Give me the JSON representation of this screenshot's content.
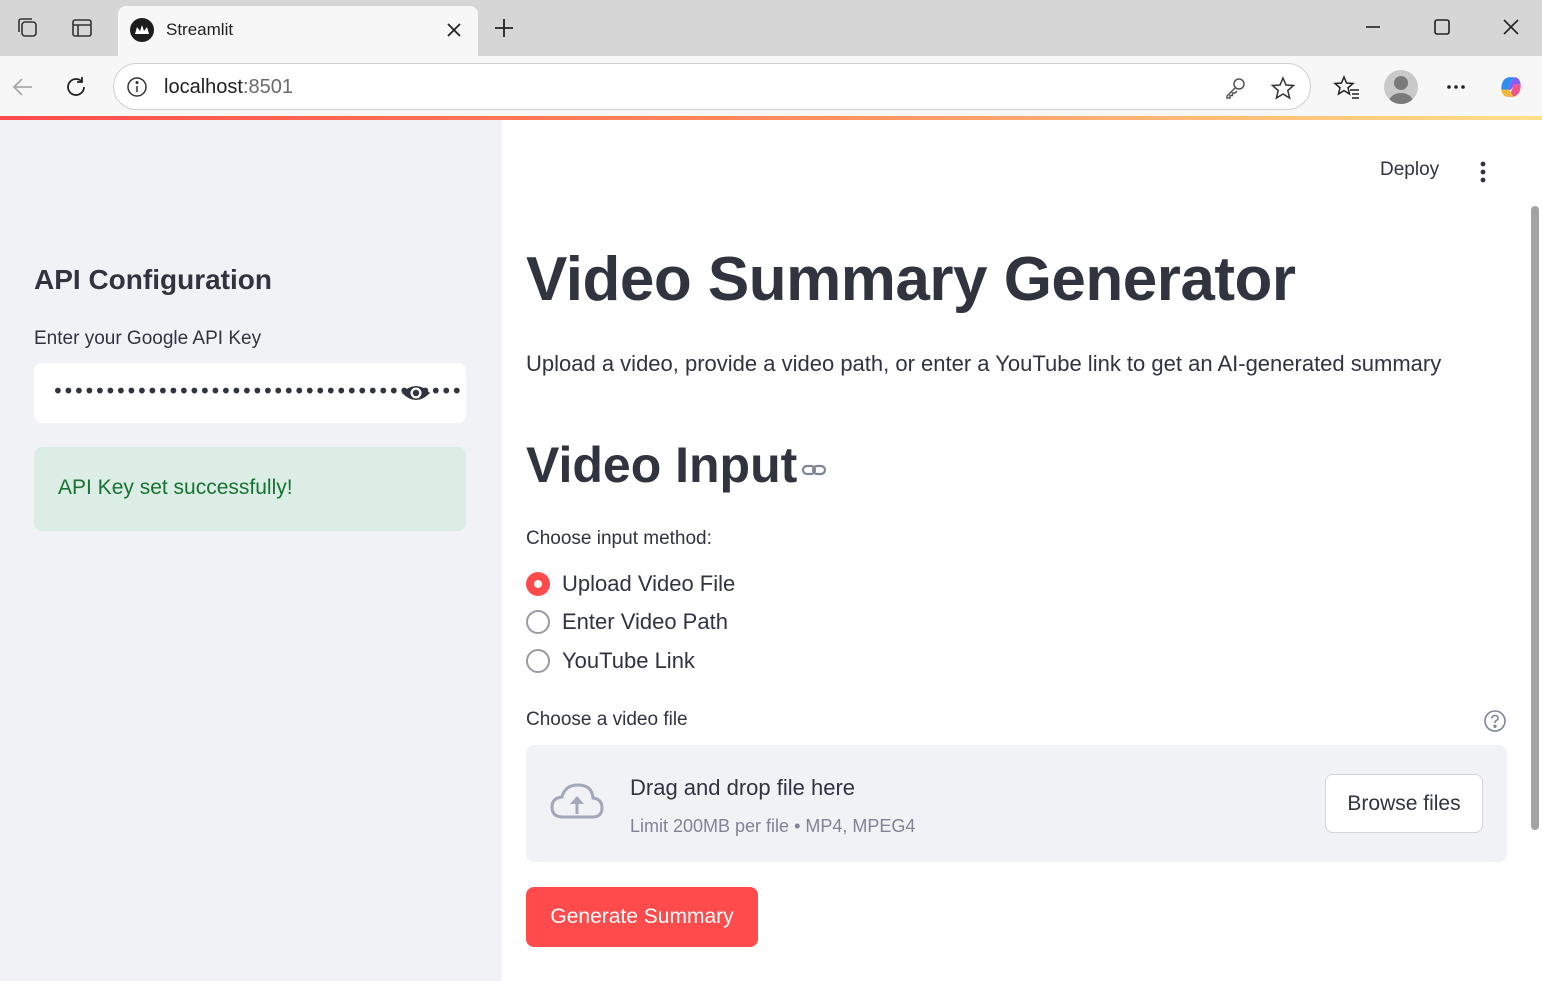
{
  "browser": {
    "tab_title": "Streamlit",
    "url_host": "localhost",
    "url_port": ":8501"
  },
  "header": {
    "deploy_label": "Deploy"
  },
  "sidebar": {
    "heading": "API Configuration",
    "api_key_label": "Enter your Google API Key",
    "api_key_masked": "•••••••••••••••••••••••••••••••••••••••",
    "success_message": "API Key set successfully!"
  },
  "main": {
    "title": "Video Summary Generator",
    "subtitle": "Upload a video, provide a video path, or enter a YouTube link to get an AI-generated summary",
    "section_heading": "Video Input",
    "radio_label": "Choose input method:",
    "radio_options": [
      "Upload Video File",
      "Enter Video Path",
      "YouTube Link"
    ],
    "selected_option": "Upload Video File",
    "uploader_label": "Choose a video file",
    "dropzone_title": "Drag and drop file here",
    "dropzone_limit": "Limit 200MB per file • MP4, MPEG4",
    "browse_label": "Browse files",
    "generate_label": "Generate Summary"
  },
  "colors": {
    "primary": "#ff4b4b",
    "sidebar_bg": "#f0f2f6",
    "success_bg": "#dcede6",
    "success_text": "#177233",
    "text": "#31333f"
  }
}
